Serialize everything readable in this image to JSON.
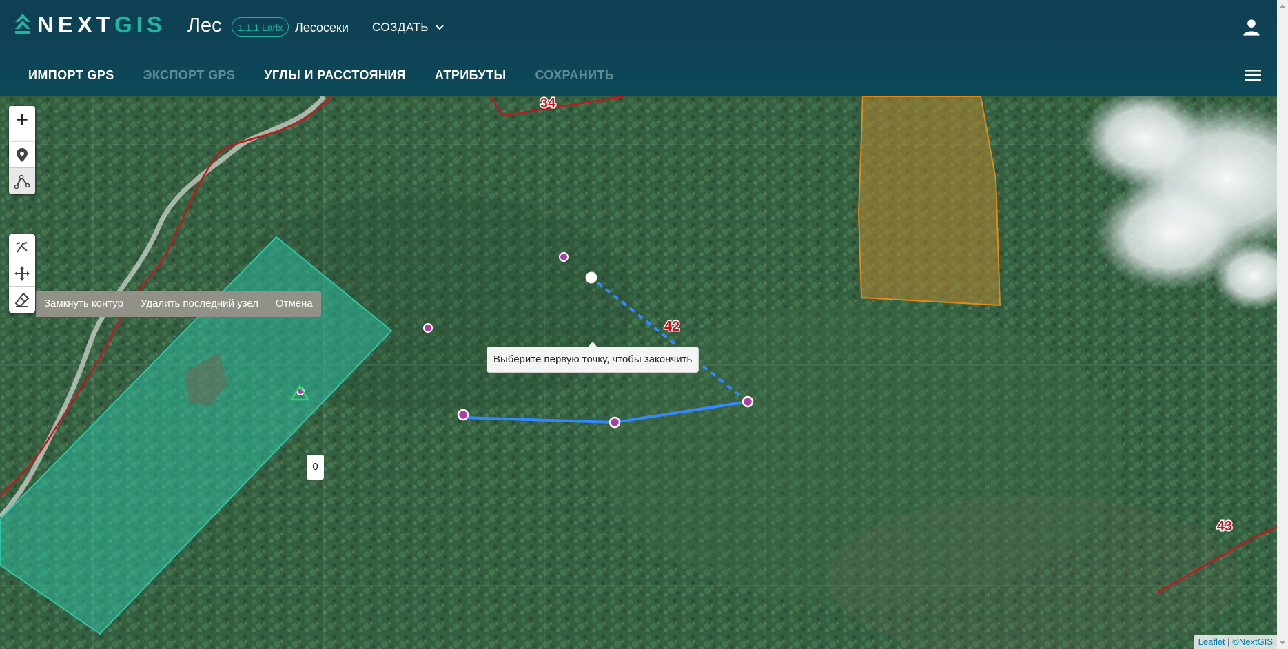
{
  "header": {
    "logo_next": "NEXT",
    "logo_gis": "GIS",
    "app_title": "Лес",
    "version": "1.1.1 Larix",
    "section": "Лесосеки",
    "create_menu": "СОЗДАТЬ",
    "user_icon": "user-icon",
    "accent_color": "#1fb5a0"
  },
  "toolbar": {
    "items": [
      {
        "label": "ИМПОРТ GPS",
        "enabled": true
      },
      {
        "label": "ЭКСПОРТ GPS",
        "enabled": false
      },
      {
        "label": "УГЛЫ И РАССТОЯНИЯ",
        "enabled": true
      },
      {
        "label": "АТРИБУТЫ",
        "enabled": true
      },
      {
        "label": "СОХРАНИТЬ",
        "enabled": false
      }
    ],
    "menu_icon": "hamburger-icon"
  },
  "map": {
    "zoom_in": "+",
    "zoom_out": "−",
    "draw_tools": [
      "marker-icon",
      "polyline-icon"
    ],
    "edit_tools": [
      "cut-icon",
      "move-icon",
      "eraser-icon"
    ],
    "draw_actions": [
      "Замкнуть контур",
      "Удалить последний узел",
      "Отмена"
    ],
    "tooltip": "Выберите первую точку, чтобы закончить",
    "plot_labels": [
      "34",
      "42",
      "43"
    ],
    "point_count": "0",
    "attribution": {
      "leaflet": "Leaflet",
      "separator": " | ",
      "provider": "©NextGIS"
    },
    "colors": {
      "drawing_line": "#3388ff",
      "boundary": "#c4161c",
      "teal_polygon": "#2ec4a8",
      "orange_polygon": "#e08a1e",
      "vertex": "#b03ca8"
    }
  }
}
